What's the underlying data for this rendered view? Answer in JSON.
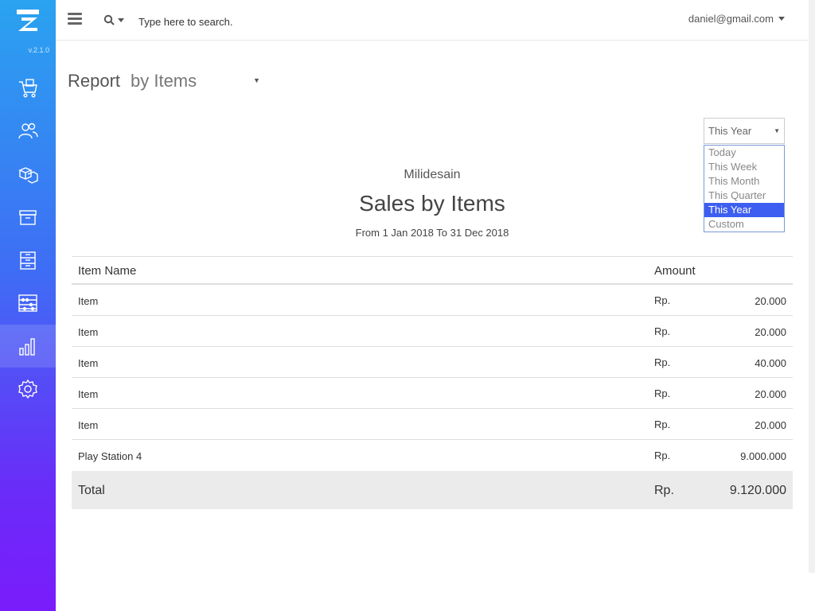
{
  "app": {
    "logo_letter": "Z",
    "version": "v.2.1.0"
  },
  "sidebar": {
    "items": [
      {
        "icon": "cart-icon"
      },
      {
        "icon": "users-icon"
      },
      {
        "icon": "boxes-icon"
      },
      {
        "icon": "archive-icon"
      },
      {
        "icon": "cabinet-icon"
      },
      {
        "icon": "abacus-icon"
      },
      {
        "icon": "bar-chart-icon",
        "active": true
      },
      {
        "icon": "gear-icon"
      }
    ]
  },
  "topbar": {
    "search_placeholder": "Type here to search.",
    "user_email": "daniel@gmail.com"
  },
  "page": {
    "title": "Report",
    "subtitle": "by Items"
  },
  "period": {
    "selected": "This Year",
    "options": [
      "Today",
      "This Week",
      "This Month",
      "This Quarter",
      "This Year",
      "Custom"
    ]
  },
  "report": {
    "company": "Milidesain",
    "title": "Sales by Items",
    "date_range": "From 1 Jan 2018 To 31 Dec 2018",
    "columns": {
      "item_name": "Item Name",
      "amount": "Amount"
    },
    "rows": [
      {
        "name": "Item",
        "currency": "Rp.",
        "amount": "20.000"
      },
      {
        "name": "Item",
        "currency": "Rp.",
        "amount": "20.000"
      },
      {
        "name": "Item",
        "currency": "Rp.",
        "amount": "40.000"
      },
      {
        "name": "Item",
        "currency": "Rp.",
        "amount": "20.000"
      },
      {
        "name": "Item",
        "currency": "Rp.",
        "amount": "20.000"
      },
      {
        "name": "Play Station 4",
        "currency": "Rp.",
        "amount": "9.000.000"
      }
    ],
    "total": {
      "label": "Total",
      "currency": "Rp.",
      "amount": "9.120.000"
    }
  },
  "colors": {
    "sidebar_top": "#2aa3f0",
    "sidebar_bottom": "#7a1cfb",
    "selected_option": "#3d5ef0",
    "total_row_bg": "#ebebeb"
  }
}
